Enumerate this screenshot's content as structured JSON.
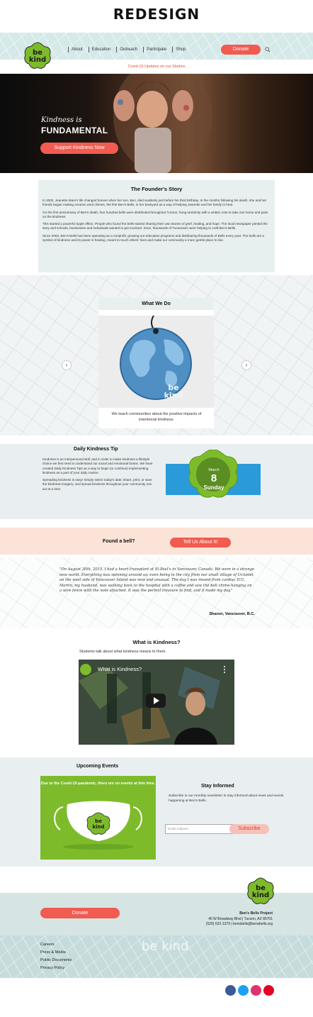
{
  "page_title": "REDESIGN",
  "header": {
    "nav": [
      "About",
      "Education",
      "Outreach",
      "Participate",
      "Shop"
    ],
    "donate_label": "Donate",
    "logo_text": "be kind"
  },
  "covid_notice": "Covid-19 Updates on our Studios",
  "hero": {
    "subtitle": "Kindness is",
    "title": "FUNDAMENTAL",
    "button_label": "Support Kindness Now"
  },
  "founder": {
    "title": "The Founder's Story",
    "paragraphs": [
      "In 2002, Jeanette Mare's life changed forever when her son, Ben, died suddenly just before his third birthday. In the months following his death, she and her friends began making ceramic wind chimes, the first Ben's Bells, in her backyard as a way of helping Jeanette and her family to heal.",
      "On the first anniversary of Ben's death, four hundred bells were distributed throughout Tucson, hung randomly with a written note to take one home and pass on the kindness.",
      "This started a powerful ripple effect. People who found the bells started sharing their own stories of grief, healing, and hope. The local newspaper printed the story and schools, businesses and individuals wanted to get involved. Soon, thousands of Tucsonans were helping to craft Ben's Bells.",
      "Since 2003, Ben's Bells has been operating as a nonprofit, growing our education programs and distributing thousands of Bells every year. The bells are a symbol of kindness and its power in healing, meant to touch others' lives and make our community a more gentle place to live."
    ]
  },
  "what_we_do": {
    "title": "What We Do",
    "caption": "We teach communities about the positive impacts of intentional kindness.",
    "prev_glyph": "‹",
    "next_glyph": "›"
  },
  "tip": {
    "title": "Daily Kindness Tip",
    "paragraphs": [
      "Kindness is an interpersonal skill, and in order to make kindness a lifestyle choice we first need to understand our social and emotional brains. We have created Daily Kindness Tips as a way to begin (or continue) implementing kindness as a part of your daily routine.",
      "Spreading kindness is easy! Simply select today's date; share, print, or save the kindness imagery; and spread kindness throughout your community one act at a time."
    ],
    "month": "March",
    "day": "8",
    "weekday": "Sunday"
  },
  "found_bell": {
    "label": "Found a bell?",
    "button_label": "Tell Us About It!"
  },
  "testimonial": {
    "quote": "\"On August 30th, 2015, I had a heart transplant at St.Paul's in Vancouver, Canada. We were in a strange new world. Everything was spinning around us; even being in the city from our small village of Ucluelet on the west side of Vancouver Island was new and unusual. The day I was moved from cardiac ICU, Martin, my husband, was walking back to the hospital with a coffee and saw the bell chime hanging on a wire fence with the note attached. It was the perfect treasure to find, and it made my day.\"",
    "author": "Sharon, Vancouver, B.C."
  },
  "what_is_kindness": {
    "title": "What is Kindness?",
    "subtitle": "Students talk about what kindness means to them.",
    "video_title": "What is Kindness?"
  },
  "events": {
    "title": "Upcoming Events",
    "message": "Due to the Covid-19 pandemic, there are no events at this time."
  },
  "newsletter": {
    "title": "Stay Informed",
    "text": "Subscribe to our monthly newsletter to stay informed about news and events happening at Ben's Bells.",
    "email_placeholder": "Email Address",
    "button_label": "Subscribe"
  },
  "footer": {
    "donate_label": "Donate",
    "org_name": "Ben's Bells Project",
    "address": "40 W Broadway Blvd | Tucson, AZ 85701",
    "contact": "(520) 622-1379 | bensbells@bensbells.org",
    "links": [
      "Careers",
      "Press & Media",
      "Public Documents",
      "Privacy Policy"
    ],
    "social": [
      {
        "name": "facebook-icon",
        "glyph": "f",
        "color": "#3b5998"
      },
      {
        "name": "twitter-icon",
        "glyph": "t",
        "color": "#1da1f2"
      },
      {
        "name": "instagram-icon",
        "glyph": "◎",
        "color": "#e1306c"
      },
      {
        "name": "pinterest-icon",
        "glyph": "p",
        "color": "#e60023"
      }
    ]
  },
  "colors": {
    "accent": "#f15b50",
    "brand_green": "#7dbb2b",
    "header_bg": "#d6e9e9"
  }
}
